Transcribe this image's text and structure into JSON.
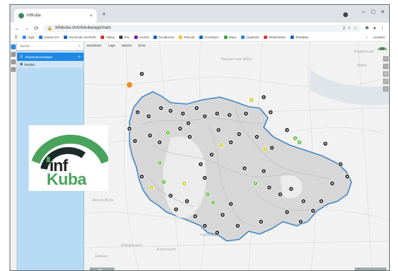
{
  "browser": {
    "tab_title": "infKuba",
    "new_tab": "+",
    "close": "×",
    "url": "infokuba.ch/infokuba/app/main",
    "minimize": "–",
    "maximize": "□",
    "window_close": "×"
  },
  "bookmarks": [
    {
      "label": "Apps",
      "color": "#4285f4"
    },
    {
      "label": "Kanton ZH",
      "color": "#1a73e8"
    },
    {
      "label": "Gemeinde Sachseln",
      "color": "#1565c0"
    },
    {
      "label": "Hiking",
      "color": "#d32f2f"
    },
    {
      "label": "GIS",
      "color": "#444444"
    },
    {
      "label": "ArcGIS",
      "color": "#7b1fa2"
    },
    {
      "label": "Geodienste",
      "color": "#1565c0"
    },
    {
      "label": "TestLab",
      "color": "#fbc02d"
    },
    {
      "label": "CloudSync",
      "color": "#1565c0"
    },
    {
      "label": "Maps",
      "color": "#43a047"
    },
    {
      "label": "Angebote",
      "color": "#1e88e5"
    },
    {
      "label": "Musterdaten",
      "color": "#e53935"
    },
    {
      "label": "Testdaten",
      "color": "#1565c0"
    }
  ],
  "bookmarks_right": {
    "other": "»",
    "reading_list": "Leseliste"
  },
  "app": {
    "search_placeholder": "Suche",
    "layer_group": "Infrastrukturanlagen",
    "layer_item": "Struktur",
    "toolbar": [
      "Basiskarte",
      "Lage",
      "Bericht",
      "Drive"
    ],
    "map_labels": {
      "north": "Hausen am Albis",
      "east": "Stäfa",
      "ne": "Hombrecht",
      "west": "Aesch Birm",
      "sw": "Immensee",
      "s": "Küssnacht",
      "sw2": "Udligenswil",
      "far_sw": "Ebikon"
    },
    "bottom_left": "Info",
    "bottom_right": ""
  },
  "logo": {
    "word1": "inf",
    "word2": "Kuba",
    "arc_color": "#4aa35c",
    "dark": "#1d2a2a"
  },
  "colors": {
    "accent": "#1e88e5",
    "sidebar": "#b7dbf4",
    "boundary": "#3f84c4",
    "region": "#d9d9d9"
  }
}
